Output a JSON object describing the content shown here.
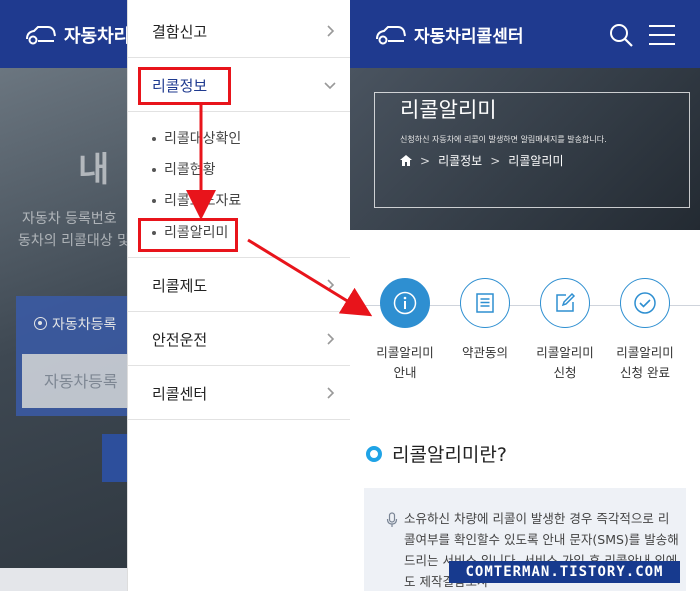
{
  "background_site": {
    "logo_text": "자동차리콜",
    "hero_title": "내 차",
    "hero_line1": "자동차 등록번호",
    "hero_line2": "동차의 리콜대상 및",
    "search_label": "자동차등록",
    "search_placeholder": "자동차등록"
  },
  "menu": {
    "items": [
      {
        "label": "결함신고",
        "expanded": false
      },
      {
        "label": "리콜정보",
        "expanded": true
      },
      {
        "label": "리콜제도",
        "expanded": false
      },
      {
        "label": "안전운전",
        "expanded": false
      },
      {
        "label": "리콜센터",
        "expanded": false
      }
    ],
    "submenu": [
      {
        "label": "리콜대상확인"
      },
      {
        "label": "리콜현황"
      },
      {
        "label": "리콜보도자료"
      },
      {
        "label": "리콜알리미"
      }
    ]
  },
  "page": {
    "logo_text": "자동차리콜센터",
    "banner_title": "리콜알리미",
    "banner_desc": "신청하신 자동차에 리콜이 발생하면 알림메세지를 발송합니다.",
    "breadcrumb": [
      "리콜정보",
      "리콜알리미"
    ],
    "steps": [
      {
        "line1": "리콜알리미",
        "line2": "안내",
        "icon": "info-icon",
        "active": true
      },
      {
        "line1": "약관동의",
        "line2": "",
        "icon": "document-icon",
        "active": false
      },
      {
        "line1": "리콜알리미",
        "line2": "신청",
        "icon": "edit-icon",
        "active": false
      },
      {
        "line1": "리콜알리미",
        "line2": "신청 완료",
        "icon": "check-icon",
        "active": false
      }
    ],
    "section_title": "리콜알리미란?",
    "info_text": "소유하신 차량에 리콜이 발생한 경우 즉각적으로 리콜여부를 확인할수 있도록 안내 문자(SMS)를 발송해 드리는 서비스 입니다. 서비스 가입 후 리콜안내 외에도 제작결함조사"
  },
  "watermark": "COMTERMAN.TISTORY.COM",
  "colors": {
    "header_blue": "#1f3a8f",
    "accent_blue": "#2e8fd1",
    "highlight_red": "#e8141b",
    "menu_active_text": "#1f3a8f"
  }
}
